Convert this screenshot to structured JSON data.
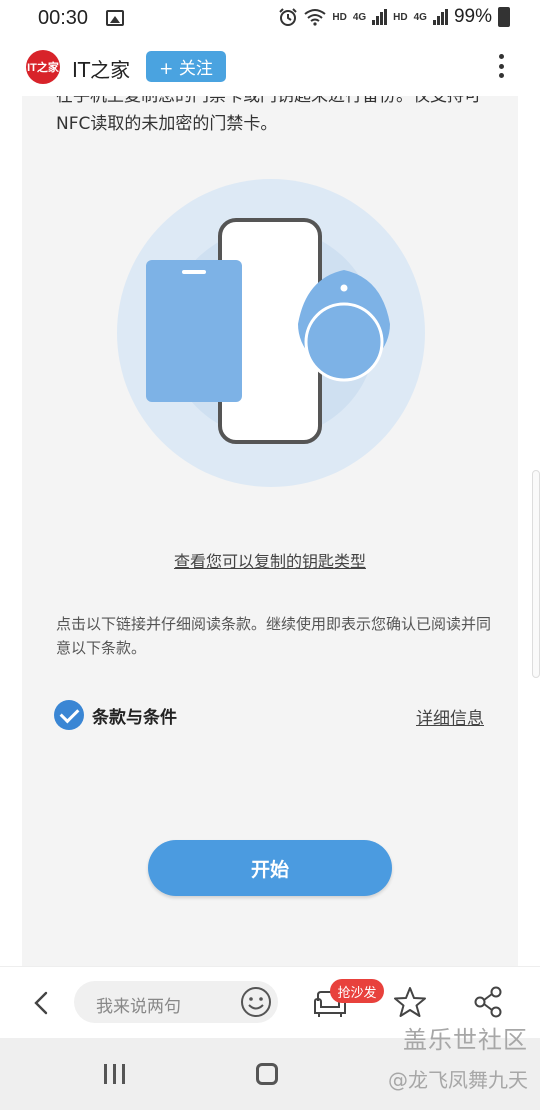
{
  "status_bar": {
    "time": "00:30",
    "hd1": "HD",
    "net1": "4G",
    "hd2": "HD",
    "net2": "4G",
    "battery": "99%"
  },
  "app_bar": {
    "logo_text": "IT之家",
    "title": "IT之家",
    "follow_label": "+ 关注"
  },
  "content": {
    "intro_text": "在手机上复制您的门禁卡或门钥匙来进行备份。仅支持可NFC读取的未加密的门禁卡。",
    "types_link": "查看您可以复制的钥匙类型",
    "terms_note": "点击以下链接并仔细阅读条款。继续使用即表示您确认已阅读并同意以下条款。",
    "terms_label": "条款与条件",
    "terms_checked": true,
    "details_link": "详细信息",
    "start_button": "开始"
  },
  "colors": {
    "accent": "#4b9be0",
    "follow": "#4aa3e0",
    "badge": "#e8413c",
    "logo": "#d8232a"
  },
  "bottom_bar": {
    "comment_placeholder": "我来说两句",
    "sofa_badge": "抢沙发",
    "icons": [
      "back-icon",
      "smile-icon",
      "sofa-icon",
      "star-icon",
      "share-icon"
    ]
  },
  "watermark": {
    "line1": "盖乐世社区",
    "line2": "@龙飞凤舞九天"
  }
}
